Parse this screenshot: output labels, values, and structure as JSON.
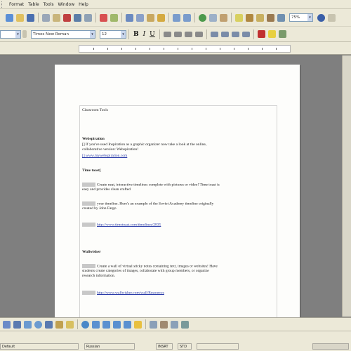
{
  "menu": [
    "Format",
    "Table",
    "Tools",
    "Window",
    "Help"
  ],
  "toolbar": {
    "zoom_value": "75%"
  },
  "formatting": {
    "style_value": "",
    "font_value": "Times New Roman",
    "size_value": "12",
    "bold": "B",
    "italic": "I",
    "underline": "U"
  },
  "document": {
    "title": "Classroom Tools",
    "sections": [
      {
        "heading": "Webspiration",
        "lines": [
          "[] If you've used Inspiration as a graphic organizer now take a look at the online,",
          "collaborative version:  Webspiration!"
        ],
        "link": "[] www.mywebspiration.com"
      },
      {
        "heading": "Time toast[",
        "lines": [
          "Create neat, interactive timelines complete with pictures or video! Time toast is",
          "easy and provides clean crafted"
        ],
        "line2": "your timeline.  Here's an example of the Soviet Academy timeline originally",
        "line3": "created by John Fargo",
        "link": "http://www.timetoast.com/timelines/2835"
      },
      {
        "heading": "Wallwisher",
        "lines": [
          "Create a wall of virtual sticky notes containing text, images or websites! Have",
          "students create categories of images, collaborate with group members, or organize",
          "research information."
        ],
        "link": "http://www.wallwisher.com/wall/Resources"
      }
    ]
  },
  "status": {
    "style": "Default",
    "language": "Russian",
    "insert": "INSRT",
    "std": "STD"
  },
  "colors": {
    "page_bg": "#fdfdfb",
    "link": "#2a3ba8",
    "chrome": "#ece9d8"
  }
}
